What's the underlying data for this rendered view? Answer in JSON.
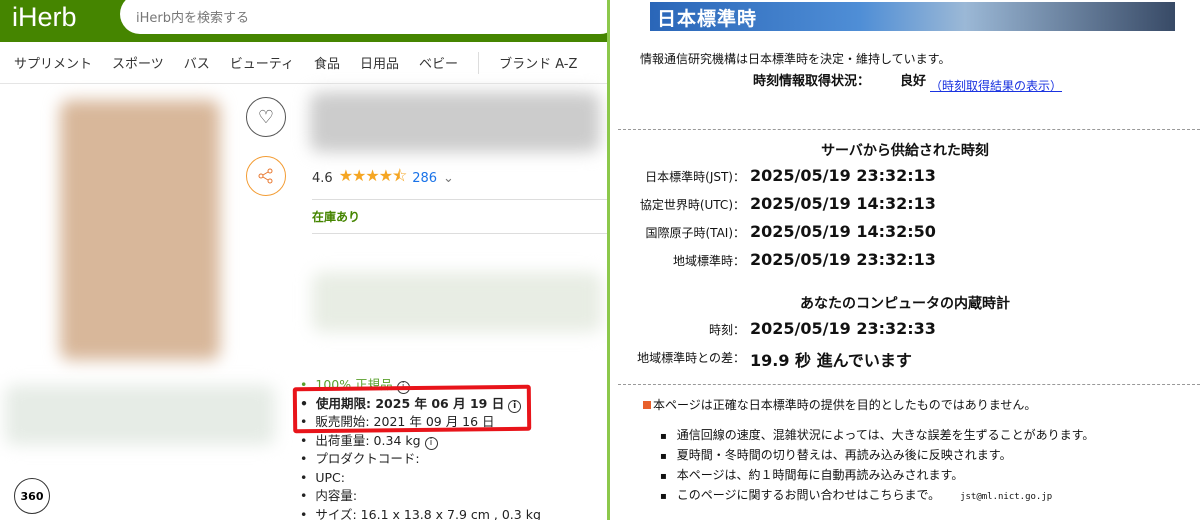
{
  "iherb": {
    "logo": "iHerb",
    "search_placeholder": "iHerb内を検索する",
    "nav": [
      "サプリメント",
      "スポーツ",
      "バス",
      "ビューティ",
      "食品",
      "日用品",
      "ベビー"
    ],
    "nav_brand": "ブランド A-Z",
    "rating": "4.6",
    "stars": "★★★★⯪",
    "review_count": "286",
    "stock": "在庫あり",
    "specs": {
      "authentic": "100% 正規品",
      "expiry_label": "使用期限:",
      "expiry_value": "2025 年 06 月 19 日",
      "release": "販売開始: 2021 年 09 月 16 日",
      "weight": "出荷重量: 0.34 kg",
      "product_code": "プロダクトコード:",
      "upc": "UPC:",
      "volume": "内容量:",
      "size": "サイズ: 16.1 x 13.8 x 7.9 cm , 0.3 kg"
    },
    "view360": "360"
  },
  "nict": {
    "banner": "日本標準時",
    "intro": "情報通信研究機構は日本標準時を決定・維持しています。",
    "status_label": "時刻情報取得状況：",
    "status_value": "良好",
    "status_link": "（時刻取得結果の表示）",
    "server_heading": "サーバから供給された時刻",
    "server_rows": [
      {
        "label": "日本標準時(JST)：",
        "value": "2025/05/19 23:32:13"
      },
      {
        "label": "協定世界時(UTC)：",
        "value": "2025/05/19 14:32:13"
      },
      {
        "label": "国際原子時(TAI)：",
        "value": "2025/05/19 14:32:50"
      },
      {
        "label": "地域標準時：",
        "value": "2025/05/19 23:32:13"
      }
    ],
    "pc_heading": "あなたのコンピュータの内蔵時計",
    "pc_rows": [
      {
        "label": "時刻：",
        "value": "2025/05/19 23:32:33"
      },
      {
        "label": "地域標準時との差：",
        "value": "19.9 秒 進んでいます"
      }
    ],
    "disclaimer": "本ページは正確な日本標準時の提供を目的としたものではありません。",
    "notes": [
      "通信回線の速度、混雑状況によっては、大きな誤差を生ずることがあります。",
      "夏時間・冬時間の切り替えは、再読み込み後に反映されます。",
      "本ページは、約１時間毎に自動再読み込みされます。",
      "このページに関するお問い合わせはこちらまで。"
    ],
    "email": "jst@ml.nict.go.jp"
  }
}
